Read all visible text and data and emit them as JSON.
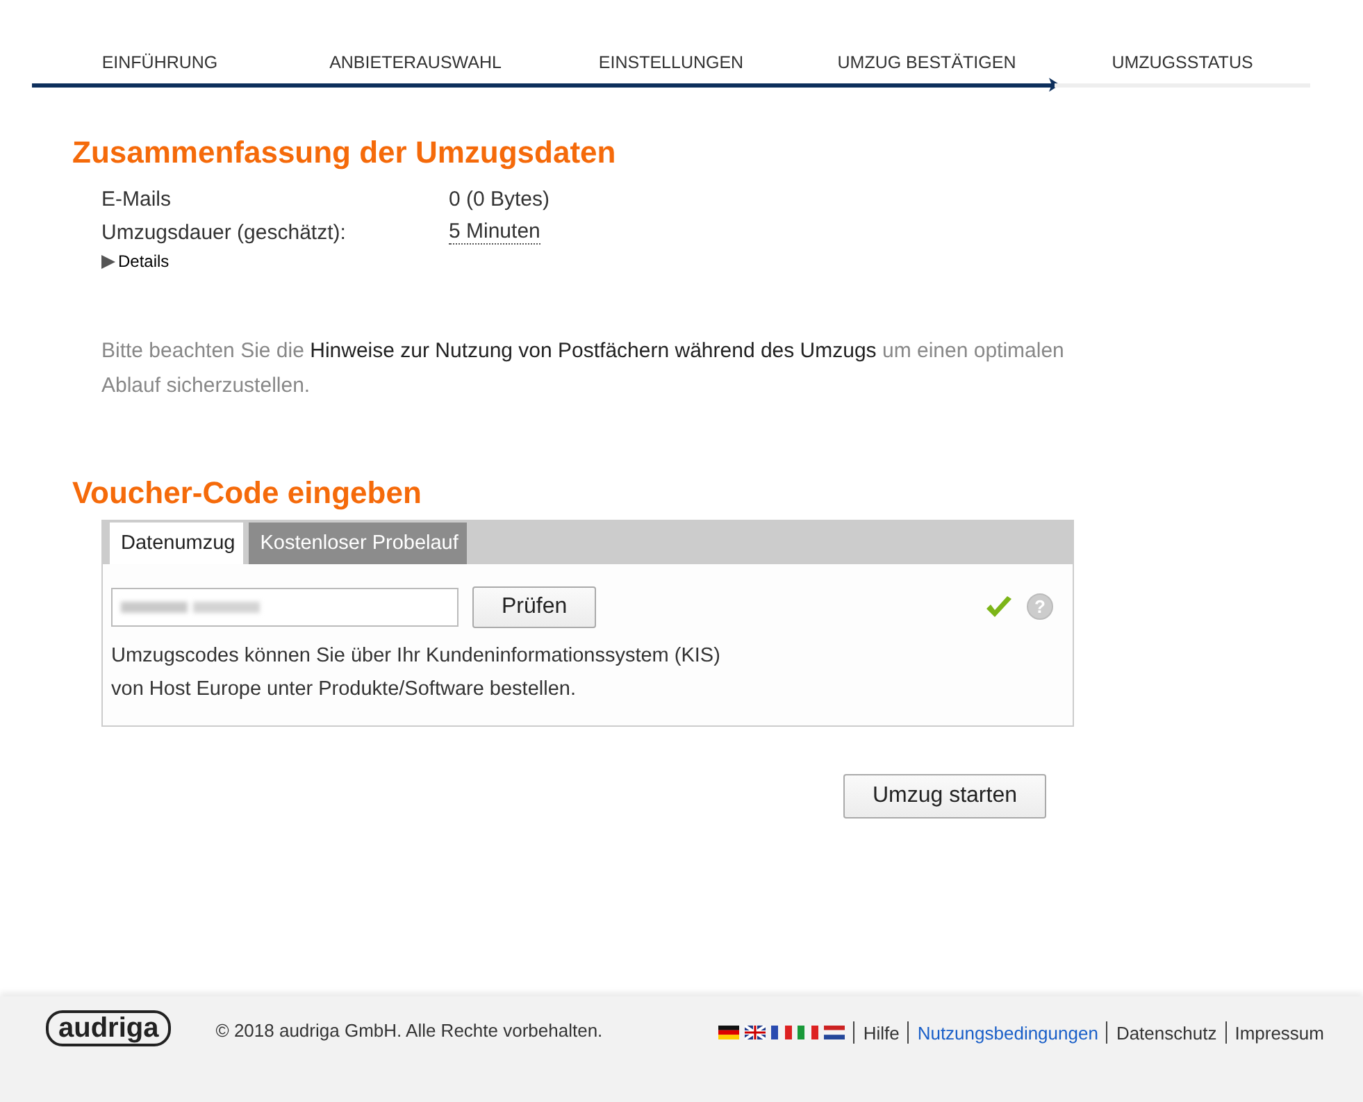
{
  "steps": [
    {
      "label": "EINFÜHRUNG",
      "completed": true,
      "selected": false
    },
    {
      "label": "ANBIETERAUSWAHL",
      "completed": true,
      "selected": false
    },
    {
      "label": "EINSTELLUNGEN",
      "completed": true,
      "selected": false
    },
    {
      "label": "UMZUG BESTÄTIGEN",
      "completed": true,
      "selected": true
    },
    {
      "label": "UMZUGSSTATUS",
      "completed": false,
      "selected": false
    }
  ],
  "summary": {
    "title": "Zusammenfassung der Umzugsdaten",
    "rows": [
      {
        "label": "E-Mails",
        "value": "0 (0 Bytes)",
        "kind": "plain"
      },
      {
        "label": "Umzugsdauer (geschätzt):",
        "value": "5 Minuten",
        "kind": "tooltip"
      }
    ],
    "details": {
      "label": "Details",
      "expanded": false
    }
  },
  "notice": {
    "before": "Bitte beachten Sie die ",
    "link": "Hinweise zur Nutzung von Postfächern während des Umzugs",
    "after": " um einen optimalen Ablauf sicherzustellen."
  },
  "voucher": {
    "title": "Voucher-Code eingeben",
    "tabs": [
      {
        "label": "Datenumzug",
        "selected": true
      },
      {
        "label": "Kostenloser Probelauf",
        "selected": false
      }
    ],
    "check_button": "Prüfen",
    "valid": true,
    "help": "?",
    "lines": [
      "Umzugscodes können Sie über Ihr Kundeninformationssystem (KIS)",
      "von Host Europe unter Produkte/Software bestellen."
    ]
  },
  "start_button": "Umzug starten",
  "footer": {
    "logo": "audriga",
    "copyright": "© 2018 audriga GmbH. Alle Rechte vorbehalten.",
    "links": [
      {
        "label": "Hilfe",
        "highlighted": false
      },
      {
        "label": "Nutzungsbedingungen",
        "highlighted": true
      },
      {
        "label": "Datenschutz",
        "highlighted": false
      },
      {
        "label": "Impressum",
        "highlighted": false
      }
    ]
  }
}
